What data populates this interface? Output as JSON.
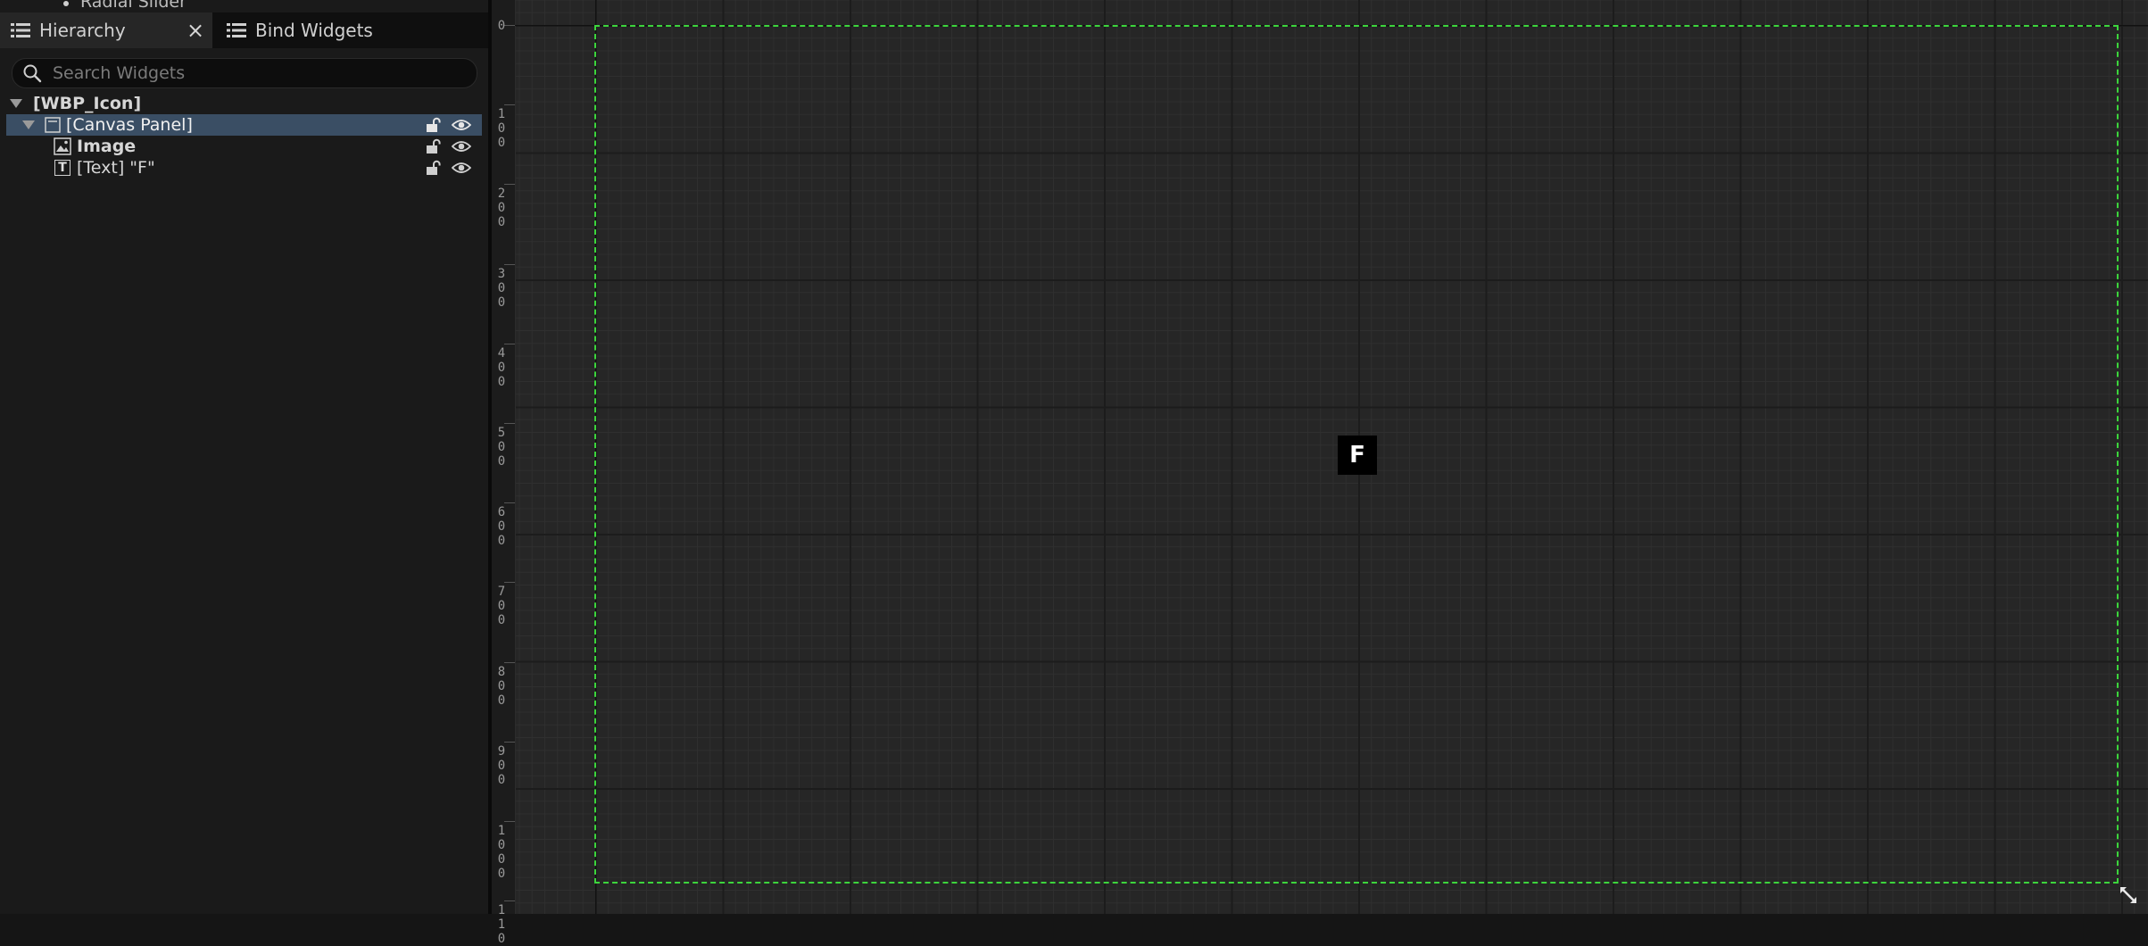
{
  "palette": {
    "visible_item": "Radial Slider"
  },
  "tabs": {
    "hierarchy": {
      "label": "Hierarchy",
      "icon": "list-icon",
      "close_symbol": "×"
    },
    "bind_widgets": {
      "label": "Bind Widgets",
      "icon": "list-icon"
    }
  },
  "search": {
    "placeholder": "Search Widgets",
    "value": ""
  },
  "tree": {
    "root": {
      "label": "[WBP_Icon]"
    },
    "canvas_panel": {
      "label": "[Canvas Panel]",
      "selected": true
    },
    "image": {
      "label": "Image",
      "icon": "image-widget-icon"
    },
    "text": {
      "label": "[Text] \"F\"",
      "icon_glyph": "T"
    }
  },
  "ruler": {
    "labels": [
      "0",
      "100",
      "200",
      "300",
      "400",
      "500",
      "600",
      "700",
      "800",
      "900",
      "1000",
      "110"
    ]
  },
  "designer": {
    "text_widget_content": "F",
    "canvas_outline_color": "#3cd53c",
    "selection_color": "#3a4e64"
  }
}
